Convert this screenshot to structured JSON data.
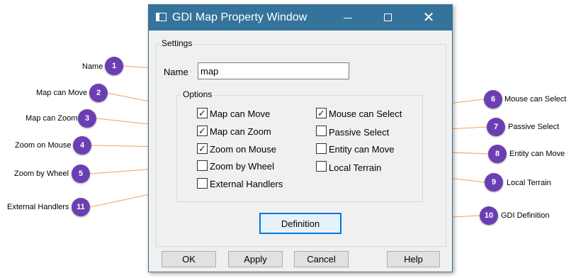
{
  "window": {
    "title": "GDI Map Property Window",
    "controls": {
      "minimize": "",
      "maximize": "",
      "close": "✕"
    }
  },
  "settings": {
    "group_label": "Settings",
    "name_label": "Name",
    "name_value": "map",
    "options_label": "Options"
  },
  "options": [
    {
      "label": "Map can Move",
      "checked": true
    },
    {
      "label": "Map can Zoom",
      "checked": true
    },
    {
      "label": "Zoom on Mouse",
      "checked": true
    },
    {
      "label": "Zoom by Wheel",
      "checked": false
    },
    {
      "label": "External Handlers",
      "checked": false
    },
    {
      "label": "Mouse can Select",
      "checked": true
    },
    {
      "label": "Passive Select",
      "checked": false
    },
    {
      "label": "Entity can Move",
      "checked": false
    },
    {
      "label": "Local Terrain",
      "checked": false
    }
  ],
  "definition_button": "Definition",
  "footer_buttons": {
    "ok": "OK",
    "apply": "Apply",
    "cancel": "Cancel",
    "help": "Help"
  },
  "callouts": [
    {
      "num": "1",
      "text": "Name"
    },
    {
      "num": "2",
      "text": "Map can Move"
    },
    {
      "num": "3",
      "text": "Map can Zoom"
    },
    {
      "num": "4",
      "text": "Zoom on Mouse"
    },
    {
      "num": "5",
      "text": "Zoom by Wheel"
    },
    {
      "num": "6",
      "text": "Mouse can Select"
    },
    {
      "num": "7",
      "text": "Passive Select"
    },
    {
      "num": "8",
      "text": "Entity can Move"
    },
    {
      "num": "9",
      "text": "Local Terrain"
    },
    {
      "num": "10",
      "text": "GDI Definition"
    },
    {
      "num": "11",
      "text": "External Handlers"
    }
  ],
  "colors": {
    "titlebar": "#34739c",
    "callout": "#6b3fb3",
    "leader_line": "#f0a35e"
  }
}
